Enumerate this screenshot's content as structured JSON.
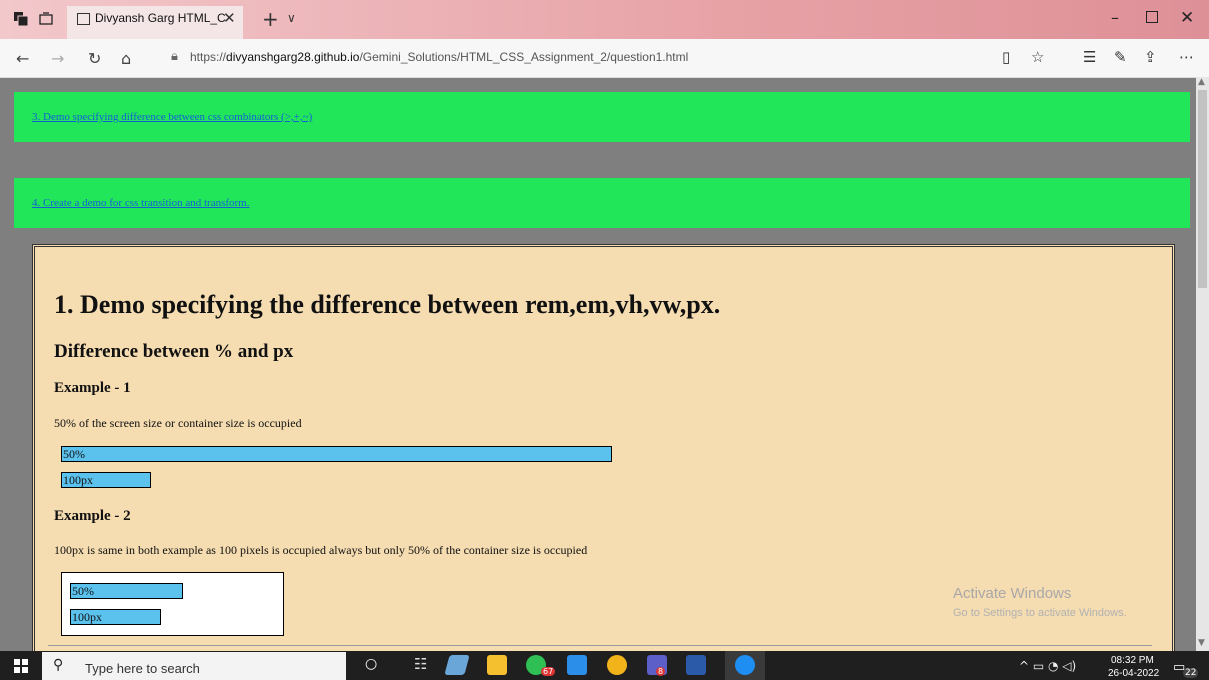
{
  "window": {
    "tab_title": "Divyansh Garg HTML_C",
    "tab_close": "✕",
    "new_tab": "+",
    "tab_menu": "∨",
    "minimize": "–",
    "close": "✕"
  },
  "address_bar": {
    "url_prefix": "https://",
    "url_host": "divyanshgarg28.github.io",
    "url_path": "/Gemini_Solutions/HTML_CSS_Assignment_2/question1.html"
  },
  "page": {
    "links": [
      "3. Demo specifying difference between css combinators (>,+,~)",
      "4. Create a demo for css transition and transform."
    ],
    "heading": "1. Demo specifying the difference between rem,em,vh,vw,px.",
    "subheading": "Difference between % and px",
    "example1": {
      "title": "Example - 1",
      "text": "50% of the screen size or container size is occupied",
      "bar_percent_label": "50%",
      "bar_px_label": "100px"
    },
    "example2": {
      "title": "Example - 2",
      "text": "100px is same in both example as 100 pixels is occupied always but only 50% of the container size is occupied",
      "bar_percent_label": "50%",
      "bar_px_label": "100px"
    },
    "watermark_title": "Activate Windows",
    "watermark_subtitle": "Go to Settings to activate Windows."
  },
  "taskbar": {
    "search_placeholder": "Type here to search",
    "time": "08:32 PM",
    "date": "26-04-2022",
    "notification_count": "22",
    "whatsapp_badge": "67",
    "teams_badge": "8",
    "colors": {
      "edge": "#1f8ef2",
      "vscode": "#2b8ee8",
      "chrome": "#f2b31a",
      "word": "#2b5aa8",
      "teams": "#5b5fc7",
      "whatsapp": "#2fbf55",
      "explorer": "#f4c02f"
    }
  },
  "colors": {
    "link_box": "#22e65a",
    "content_bg": "#f5dcb1",
    "bar_fill": "#5bc2ee",
    "page_bg": "#7f7f7f"
  }
}
